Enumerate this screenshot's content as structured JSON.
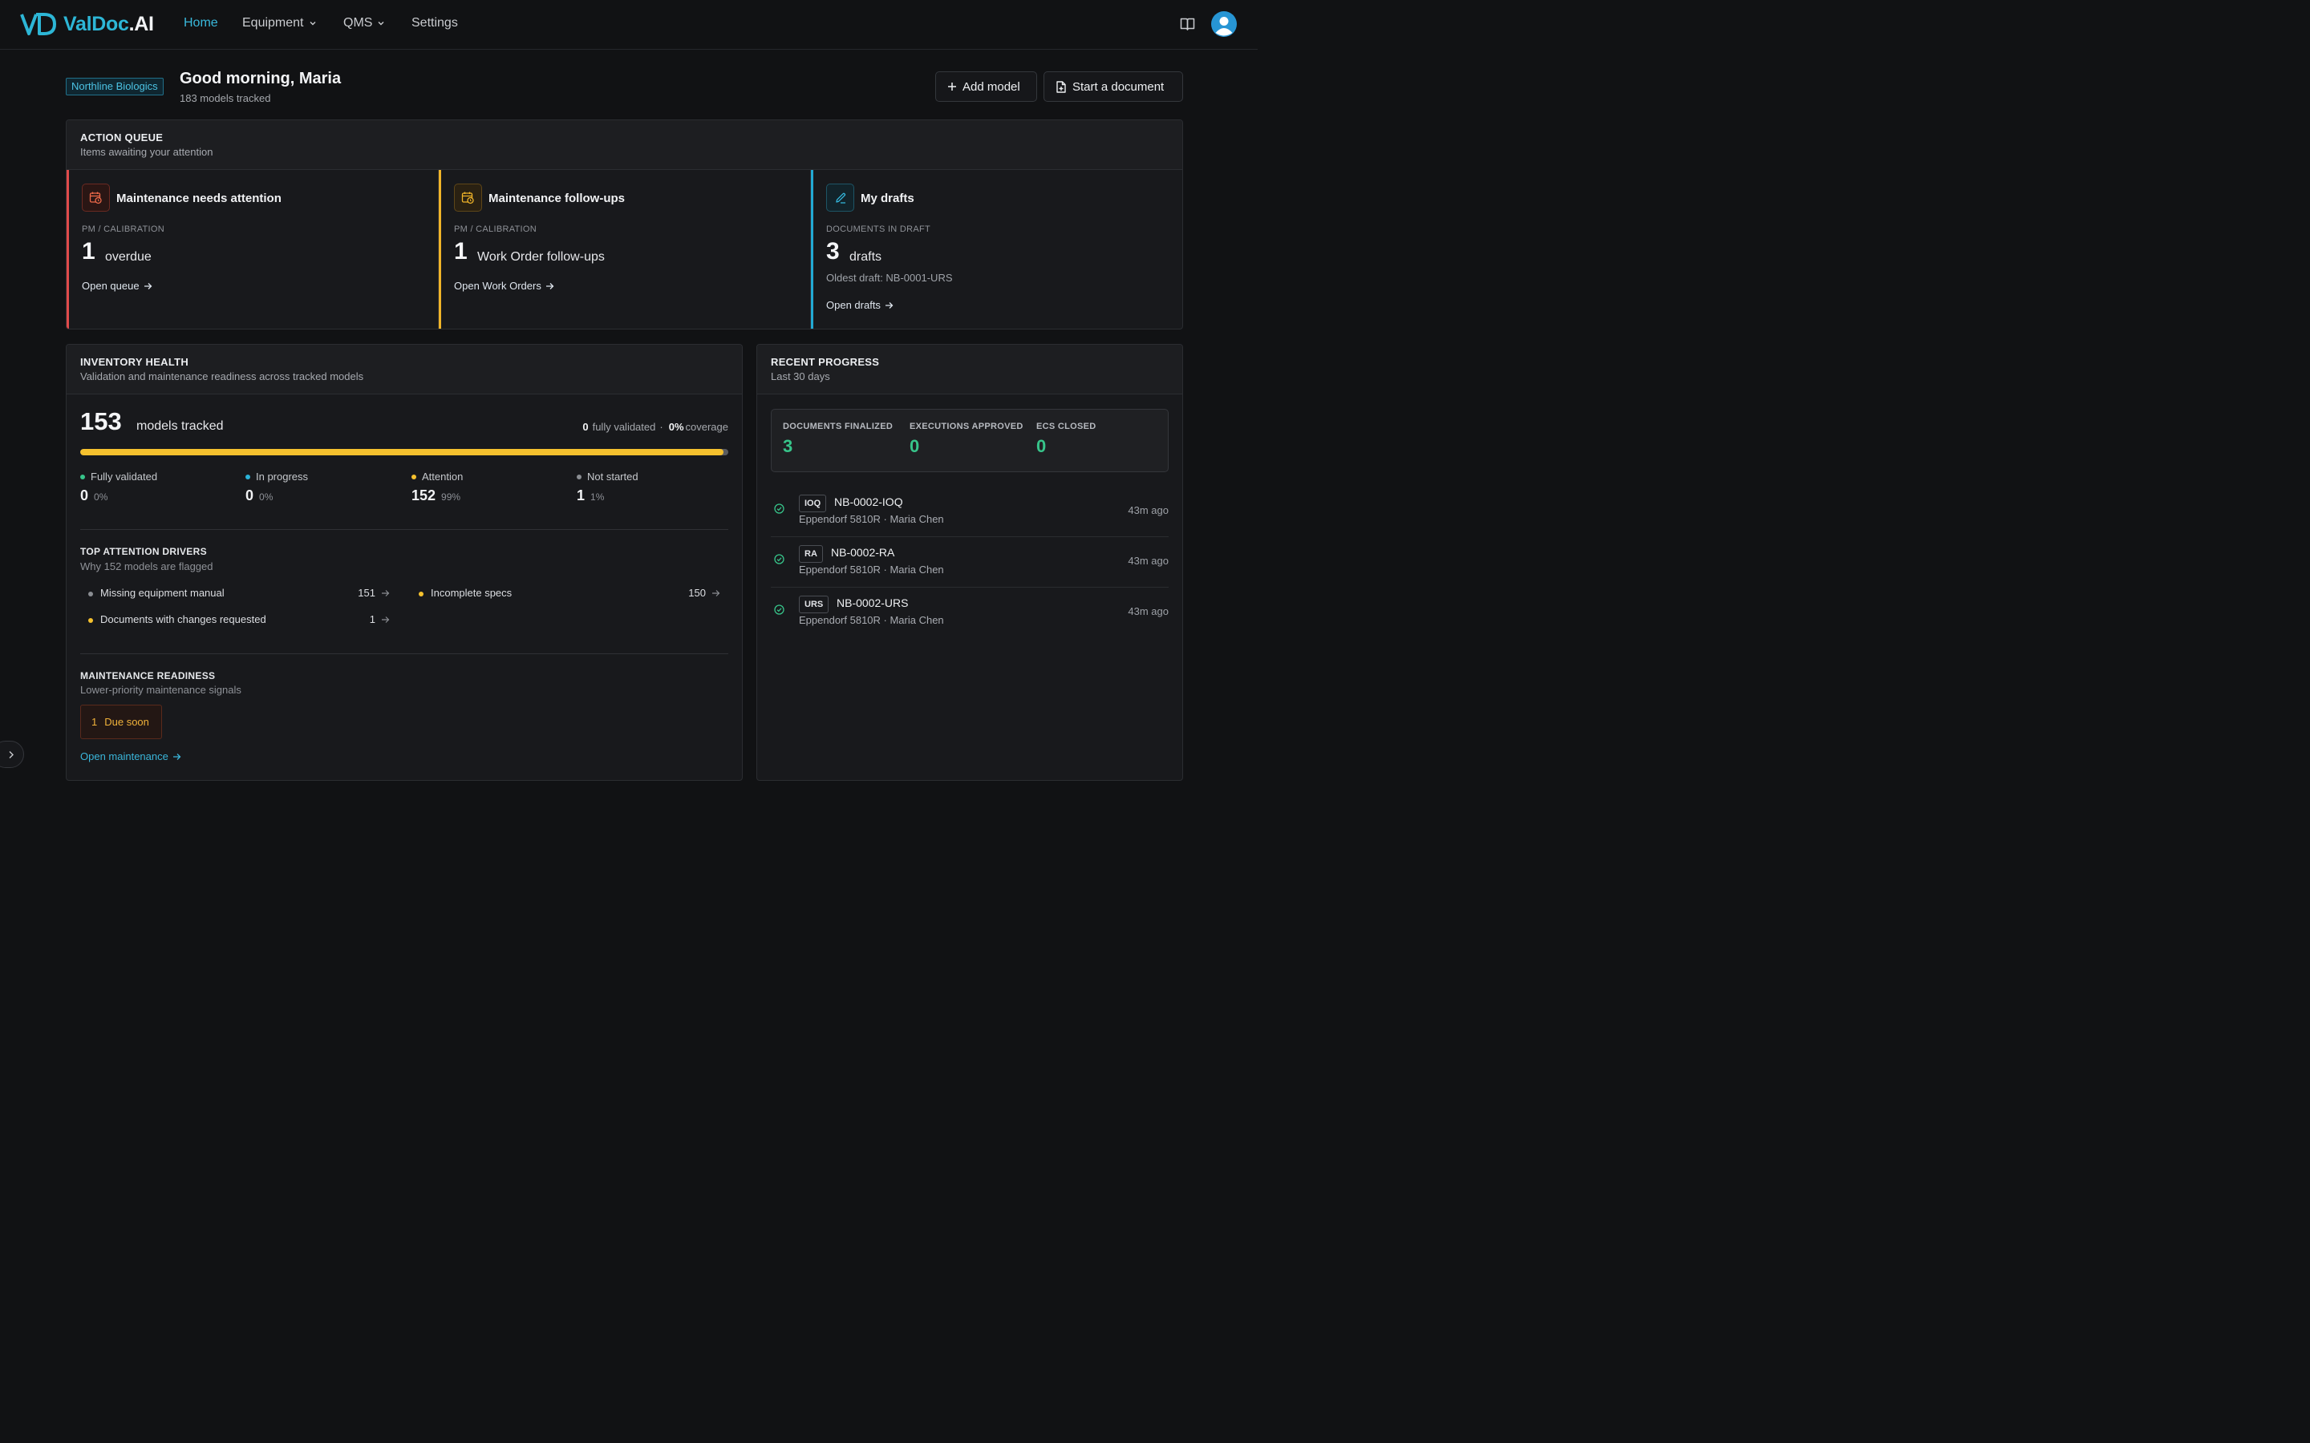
{
  "brand": {
    "name_main": "ValDoc",
    "name_suffix": ".AI",
    "color": "#2db6d6"
  },
  "nav": {
    "home": "Home",
    "equipment": "Equipment",
    "qms": "QMS",
    "settings": "Settings"
  },
  "header": {
    "org": "Northline Biologics",
    "greeting": "Good morning, Maria",
    "subtitle": "183 models tracked",
    "add_model": "Add model",
    "start_document": "Start a document"
  },
  "action_queue": {
    "title": "ACTION QUEUE",
    "subtitle": "Items awaiting your attention",
    "cards": [
      {
        "title": "Maintenance needs attention",
        "label": "PM / CALIBRATION",
        "count": "1",
        "unit": "overdue",
        "link": "Open queue",
        "color": "#e04a4a"
      },
      {
        "title": "Maintenance follow-ups",
        "label": "PM / CALIBRATION",
        "count": "1",
        "unit": "Work Order follow-ups",
        "link": "Open Work Orders",
        "color": "#f0b429"
      },
      {
        "title": "My drafts",
        "label": "DOCUMENTS IN DRAFT",
        "count": "3",
        "unit": "drafts",
        "extra": "Oldest draft: NB-0001-URS",
        "link": "Open drafts",
        "color": "#22a9d3"
      }
    ]
  },
  "inventory": {
    "title": "INVENTORY HEALTH",
    "subtitle": "Validation and maintenance readiness across tracked models",
    "total": "153",
    "total_unit": "models tracked",
    "validated_count": "0",
    "validated_label": "fully validated",
    "sep": "·",
    "coverage": "0%",
    "coverage_label": "coverage",
    "attention_fraction": 0.993,
    "stats": [
      {
        "label": "Fully validated",
        "value": "0",
        "pct": "0%",
        "color": "#37c48a"
      },
      {
        "label": "In progress",
        "value": "0",
        "pct": "0%",
        "color": "#2bb3d8"
      },
      {
        "label": "Attention",
        "value": "152",
        "pct": "99%",
        "color": "#f5c12e"
      },
      {
        "label": "Not started",
        "value": "1",
        "pct": "1%",
        "color": "#8a8d92"
      }
    ],
    "drivers_title": "TOP ATTENTION DRIVERS",
    "drivers_sub": "Why 152 models are flagged",
    "drivers": [
      {
        "label": "Missing equipment manual",
        "count": "151",
        "color": "#8a8d92"
      },
      {
        "label": "Incomplete specs",
        "count": "150",
        "color": "#f5c12e"
      },
      {
        "label": "Documents with changes requested",
        "count": "1",
        "color": "#f5c12e"
      }
    ],
    "maint_title": "MAINTENANCE READINESS",
    "maint_sub": "Lower-priority maintenance signals",
    "due_count": "1",
    "due_label": "Due soon",
    "maint_link": "Open maintenance"
  },
  "recent": {
    "title": "RECENT PROGRESS",
    "subtitle": "Last 30 days",
    "kpis": [
      {
        "label": "DOCUMENTS FINALIZED",
        "value": "3"
      },
      {
        "label": "EXECUTIONS APPROVED",
        "value": "0"
      },
      {
        "label": "ECS CLOSED",
        "value": "0"
      }
    ],
    "items": [
      {
        "tag": "IOQ",
        "id": "NB-0002-IOQ",
        "meta": "Eppendorf 5810R · Maria Chen",
        "time": "43m ago"
      },
      {
        "tag": "RA",
        "id": "NB-0002-RA",
        "meta": "Eppendorf 5810R · Maria Chen",
        "time": "43m ago"
      },
      {
        "tag": "URS",
        "id": "NB-0002-URS",
        "meta": "Eppendorf 5810R · Maria Chen",
        "time": "43m ago"
      }
    ]
  }
}
